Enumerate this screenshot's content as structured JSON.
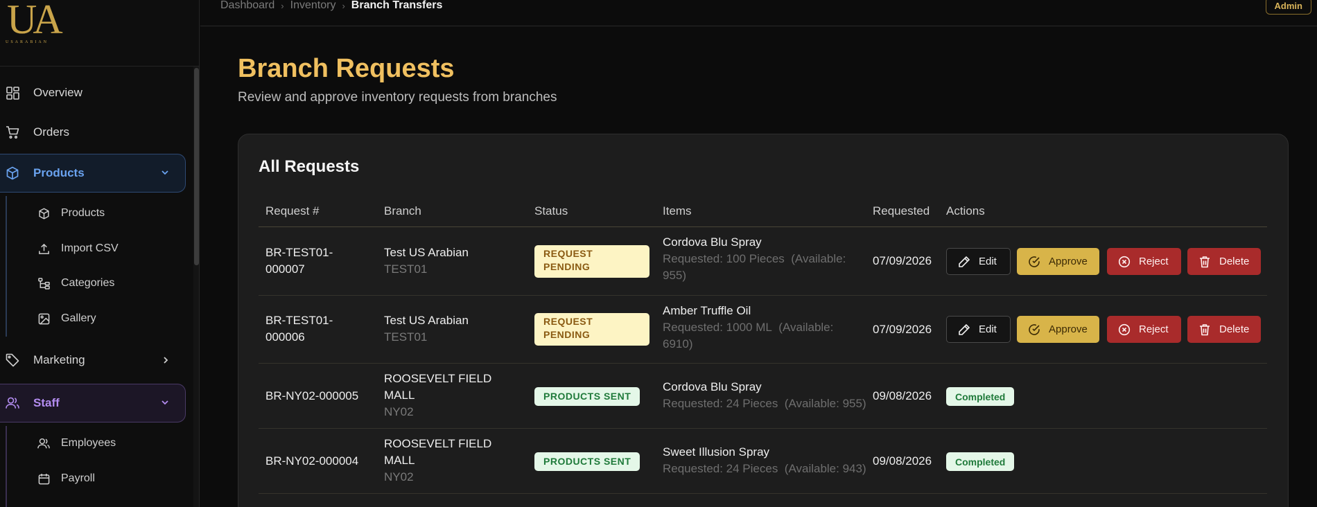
{
  "logo": {
    "mark": "UA",
    "brand": "USARABIAN"
  },
  "sidebar": {
    "items": [
      {
        "label": "Overview",
        "icon": "grid-icon"
      },
      {
        "label": "Orders",
        "icon": "cart-icon"
      },
      {
        "label": "Products",
        "icon": "cube-icon",
        "expanded": true,
        "children": [
          {
            "label": "Products",
            "icon": "cube-icon"
          },
          {
            "label": "Import CSV",
            "icon": "upload-icon"
          },
          {
            "label": "Categories",
            "icon": "tree-icon"
          },
          {
            "label": "Gallery",
            "icon": "image-icon"
          }
        ]
      },
      {
        "label": "Marketing",
        "icon": "tag-icon",
        "expanded": false
      },
      {
        "label": "Staff",
        "icon": "users-icon",
        "expanded": true,
        "children": [
          {
            "label": "Employees",
            "icon": "users-icon"
          },
          {
            "label": "Payroll",
            "icon": "calendar-icon"
          }
        ]
      }
    ]
  },
  "breadcrumb": {
    "items": [
      "Dashboard",
      "Inventory"
    ],
    "current": "Branch Transfers"
  },
  "header": {
    "badge": "Admin"
  },
  "page": {
    "title": "Branch Requests",
    "subtitle": "Review and approve inventory requests from branches"
  },
  "card": {
    "title": "All Requests"
  },
  "table": {
    "columns": [
      "Request #",
      "Branch",
      "Status",
      "Items",
      "Requested",
      "Actions"
    ],
    "rows": [
      {
        "request_line1": "BR-TEST01-",
        "request_line2": "000007",
        "branch_line1": "Test US Arabian",
        "branch_line2": "",
        "branch_code": "TEST01",
        "status": "REQUEST PENDING",
        "item": "Cordova Blu Spray",
        "requested_text": "Requested: 100 Pieces",
        "available_line1": "(Available:",
        "available_line2": "955)",
        "date": "07/09/2026",
        "actions": [
          "Edit",
          "Approve",
          "Reject",
          "Delete"
        ]
      },
      {
        "request_line1": "BR-TEST01-",
        "request_line2": "000006",
        "branch_line1": "Test US Arabian",
        "branch_line2": "",
        "branch_code": "TEST01",
        "status": "REQUEST PENDING",
        "item": "Amber Truffle Oil",
        "requested_text": "Requested: 1000 ML",
        "available_line1": "(Available:",
        "available_line2": "6910)",
        "date": "07/09/2026",
        "actions": [
          "Edit",
          "Approve",
          "Reject",
          "Delete"
        ]
      },
      {
        "request_line1": "BR-NY02-000005",
        "request_line2": "",
        "branch_line1": "ROOSEVELT FIELD",
        "branch_line2": "MALL",
        "branch_code": "NY02",
        "status": "PRODUCTS SENT",
        "item": "Cordova Blu Spray",
        "requested_text": "Requested: 24 Pieces",
        "available_line1": "(Available: 955)",
        "available_line2": "",
        "date": "09/08/2026",
        "completed": "Completed"
      },
      {
        "request_line1": "BR-NY02-000004",
        "request_line2": "",
        "branch_line1": "ROOSEVELT FIELD",
        "branch_line2": "MALL",
        "branch_code": "NY02",
        "status": "PRODUCTS SENT",
        "item": "Sweet Illusion Spray",
        "requested_text": "Requested: 24 Pieces",
        "available_line1": "(Available: 943)",
        "available_line2": "",
        "date": "09/08/2026",
        "completed": "Completed"
      }
    ]
  },
  "colors": {
    "accent_gold": "#f0c060",
    "products_blue": "#6aa3f0",
    "staff_purple": "#b38cf0",
    "reject_red": "#a92b2b",
    "approve_gold": "#d8b449"
  }
}
